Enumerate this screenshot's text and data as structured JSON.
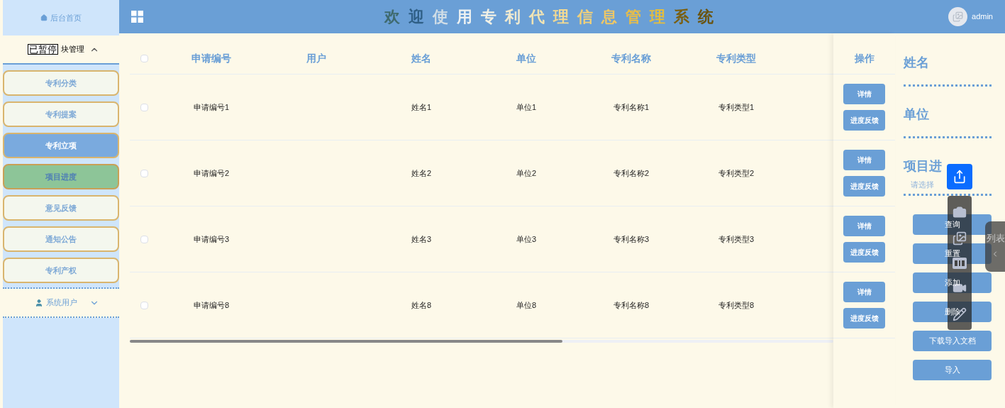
{
  "sidebar": {
    "home": "后台首页",
    "groups": [
      {
        "paused_badge": "已暂停",
        "label": "块管理",
        "expanded": true,
        "items": [
          {
            "label": "专利分类",
            "selected": false,
            "hovered": false
          },
          {
            "label": "专利提案",
            "selected": false,
            "hovered": false
          },
          {
            "label": "专利立项",
            "selected": true,
            "hovered": false
          },
          {
            "label": "项目进度",
            "selected": false,
            "hovered": true
          },
          {
            "label": "意见反馈",
            "selected": false,
            "hovered": false
          },
          {
            "label": "通知公告",
            "selected": false,
            "hovered": false
          },
          {
            "label": "专利产权",
            "selected": false,
            "hovered": false
          }
        ]
      },
      {
        "label": "系统用户",
        "expanded": false
      }
    ]
  },
  "header": {
    "title": "欢迎使用专利代理信息管理系统",
    "user": "admin"
  },
  "table": {
    "all_checked": false,
    "columns": [
      "申请编号",
      "用户",
      "姓名",
      "单位",
      "专利名称",
      "专利类型"
    ],
    "action_column": "操作",
    "rows": [
      {
        "checked": false,
        "cells": [
          "申请编号1",
          "",
          "姓名1",
          "单位1",
          "专利名称1",
          "专利类型1"
        ],
        "actions": [
          "详情",
          "进度反馈"
        ]
      },
      {
        "checked": false,
        "cells": [
          "申请编号2",
          "",
          "姓名2",
          "单位2",
          "专利名称2",
          "专利类型2"
        ],
        "actions": [
          "详情",
          "进度反馈"
        ]
      },
      {
        "checked": false,
        "cells": [
          "申请编号3",
          "",
          "姓名3",
          "单位3",
          "专利名称3",
          "专利类型3"
        ],
        "actions": [
          "详情",
          "进度反馈"
        ]
      },
      {
        "checked": false,
        "cells": [
          "申请编号8",
          "",
          "姓名8",
          "单位8",
          "专利名称8",
          "专利类型8"
        ],
        "actions": [
          "详情",
          "进度反馈"
        ]
      }
    ]
  },
  "search": {
    "fields": [
      {
        "label": "姓名",
        "kind": "text"
      },
      {
        "label": "单位",
        "kind": "text"
      },
      {
        "label": "项目进",
        "kind": "select",
        "placeholder": "请选择"
      }
    ],
    "buttons": [
      "查询",
      "重置",
      "添加",
      "删除",
      "下载导入文档",
      "导入"
    ]
  },
  "side_tab": {
    "label": "列表"
  }
}
